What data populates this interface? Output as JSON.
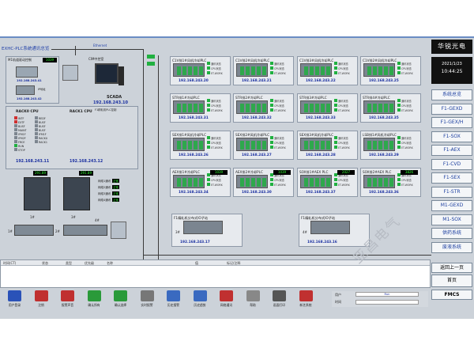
{
  "header": {
    "title": "EXHC-PLC系统通讯总览",
    "network": "Ethernet"
  },
  "brand": "华锐光电",
  "datetime": {
    "date": "2021/1/23",
    "time": "10:44:25"
  },
  "left": {
    "m1": {
      "title": "M1轨道驱动控制",
      "counter": "1039",
      "ip1": "192.168.243.41",
      "ip2": "192.168.243.42",
      "ip_label": "IP地址"
    },
    "scada": {
      "title": "CIM中控室",
      "name": "SCADA",
      "ip": "192.168.243.10"
    },
    "plc": {
      "title": "F1精轧机PLC控制",
      "cpu1": "RACK0 CPU",
      "cpu2": "RACK1 CPU",
      "ip1": "192.168.243.11",
      "ip2": "192.168.243.12"
    },
    "cpu_status_labels": [
      "INTF",
      "EXTF",
      "BUSF",
      "MAINT",
      "IFM1F",
      "IFM2F",
      "FRCE",
      "RUN",
      "STOP"
    ],
    "cpu_status_labels2": [
      "REDF",
      "BUSF",
      "BUSF",
      "BUSF",
      "IFM1F",
      "RACK0",
      "RACK1"
    ],
    "racks": [
      {
        "label": "1#",
        "value": "291.89",
        "num": "1#"
      },
      {
        "label": "2#",
        "value": "291.89",
        "num": "3#"
      }
    ],
    "rack_lines": [
      "网络1通讯",
      "网络2通讯",
      "网络3通讯",
      "网络4通讯"
    ],
    "rack_line_status": "正常",
    "rack_bottom": [
      "2#",
      "4#"
    ]
  },
  "middle": {
    "rows": [
      [
        "C1V排1#风机冷却PLC",
        "C1V排2#风机冷却PLC",
        "C1V排3#风机冷却PLC",
        "C1V排2#风机冷却PLC"
      ],
      [
        "STR排1#冷却PLC",
        "STR排2#冷却PLC",
        "STR排3#冷却PLC",
        "STR排4#冷却PLC"
      ],
      [
        "SEX排1#风机冷却PLC",
        "SEX排2#风机冷却PLC",
        "SEX排3#风机冷却PLC",
        "LSB排1#风机冷却PLC"
      ],
      [
        "AEX排1#冷却PLC",
        "AEX排2#冷却PLC",
        "SOX排1#AEX PLC",
        "SOX排2#AEX PLC"
      ]
    ],
    "ips": [
      [
        "192.168.243.20",
        "192.168.243.21",
        "192.168.243.22",
        "192.168.243.25"
      ],
      [
        "192.168.243.31",
        "192.168.243.32",
        "192.168.243.33",
        "192.168.243.35"
      ],
      [
        "192.168.243.26",
        "192.168.243.27",
        "192.168.243.28",
        "192.168.243.29"
      ],
      [
        "192.168.243.34",
        "192.168.243.30",
        "192.168.243.37",
        "192.168.243.36"
      ]
    ],
    "counters": [
      "1039",
      "1039",
      "2027",
      "3826"
    ],
    "status_lines": [
      "通讯状态",
      "CPU状态",
      "ET-WORK"
    ],
    "bottom_left": {
      "title": "F1精轧机分布式IO子站",
      "label": "3#",
      "ip": "192.168.243.17"
    },
    "bottom_right": {
      "title": "F1精轧机分布式IO子站",
      "label": "4#",
      "ip": "192.168.243.16"
    }
  },
  "sidebar": [
    "系统总览",
    "F1-GEXD",
    "F1-GEX/H",
    "F1-SOX",
    "F1-AEX",
    "F1-CVD",
    "F1-SEX",
    "F1-STR",
    "M1-GEXD",
    "M1-SOX",
    "供药系统",
    "废液系统"
  ],
  "nav": {
    "back": "返回上一页",
    "home": "首页",
    "fmcs": "FMCS"
  },
  "alarm_table": {
    "columns": [
      "时间(CT)",
      "状态",
      "类型",
      "优先级",
      "名称",
      "值",
      "标记/注释"
    ]
  },
  "toolbar": [
    {
      "label": "用户登录",
      "color": "#2a52b8"
    },
    {
      "label": "注销",
      "color": "#c03030"
    },
    {
      "label": "报警声音",
      "color": "#c03030"
    },
    {
      "label": "确认所有",
      "color": "#2a9a3a"
    },
    {
      "label": "确认选择",
      "color": "#2a9a3a"
    },
    {
      "label": "实时报警",
      "color": "#777777"
    },
    {
      "label": "历史报警",
      "color": "#3a6ac0"
    },
    {
      "label": "历史趋势",
      "color": "#3a6ac0"
    },
    {
      "label": "网络通讯",
      "color": "#c03030"
    },
    {
      "label": "帮助",
      "color": "#888888"
    },
    {
      "label": "画面打印",
      "color": "#555555"
    },
    {
      "label": "新艺系统",
      "color": "#c03030"
    }
  ],
  "user": {
    "label": "用户",
    "value": "Run",
    "time_label": "时间"
  },
  "watermark": "亚昌电气"
}
